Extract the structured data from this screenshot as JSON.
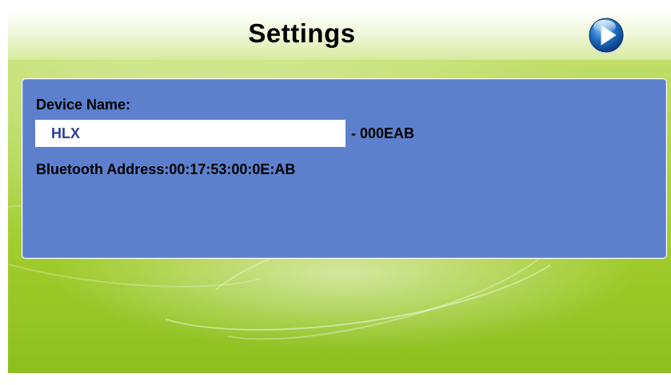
{
  "header": {
    "title": "Settings",
    "next_icon": "play-arrow-icon"
  },
  "device": {
    "name_label": "Device Name:",
    "name_value": "HLX",
    "name_suffix": "- 000EAB",
    "bluetooth_address": "Bluetooth Address:00:17:53:00:0E:AB"
  },
  "colors": {
    "panel": "#5d80cc",
    "background_green": "#a6d03a",
    "input_text": "#2f3f9a",
    "button_blue": "#1f6fc4"
  }
}
